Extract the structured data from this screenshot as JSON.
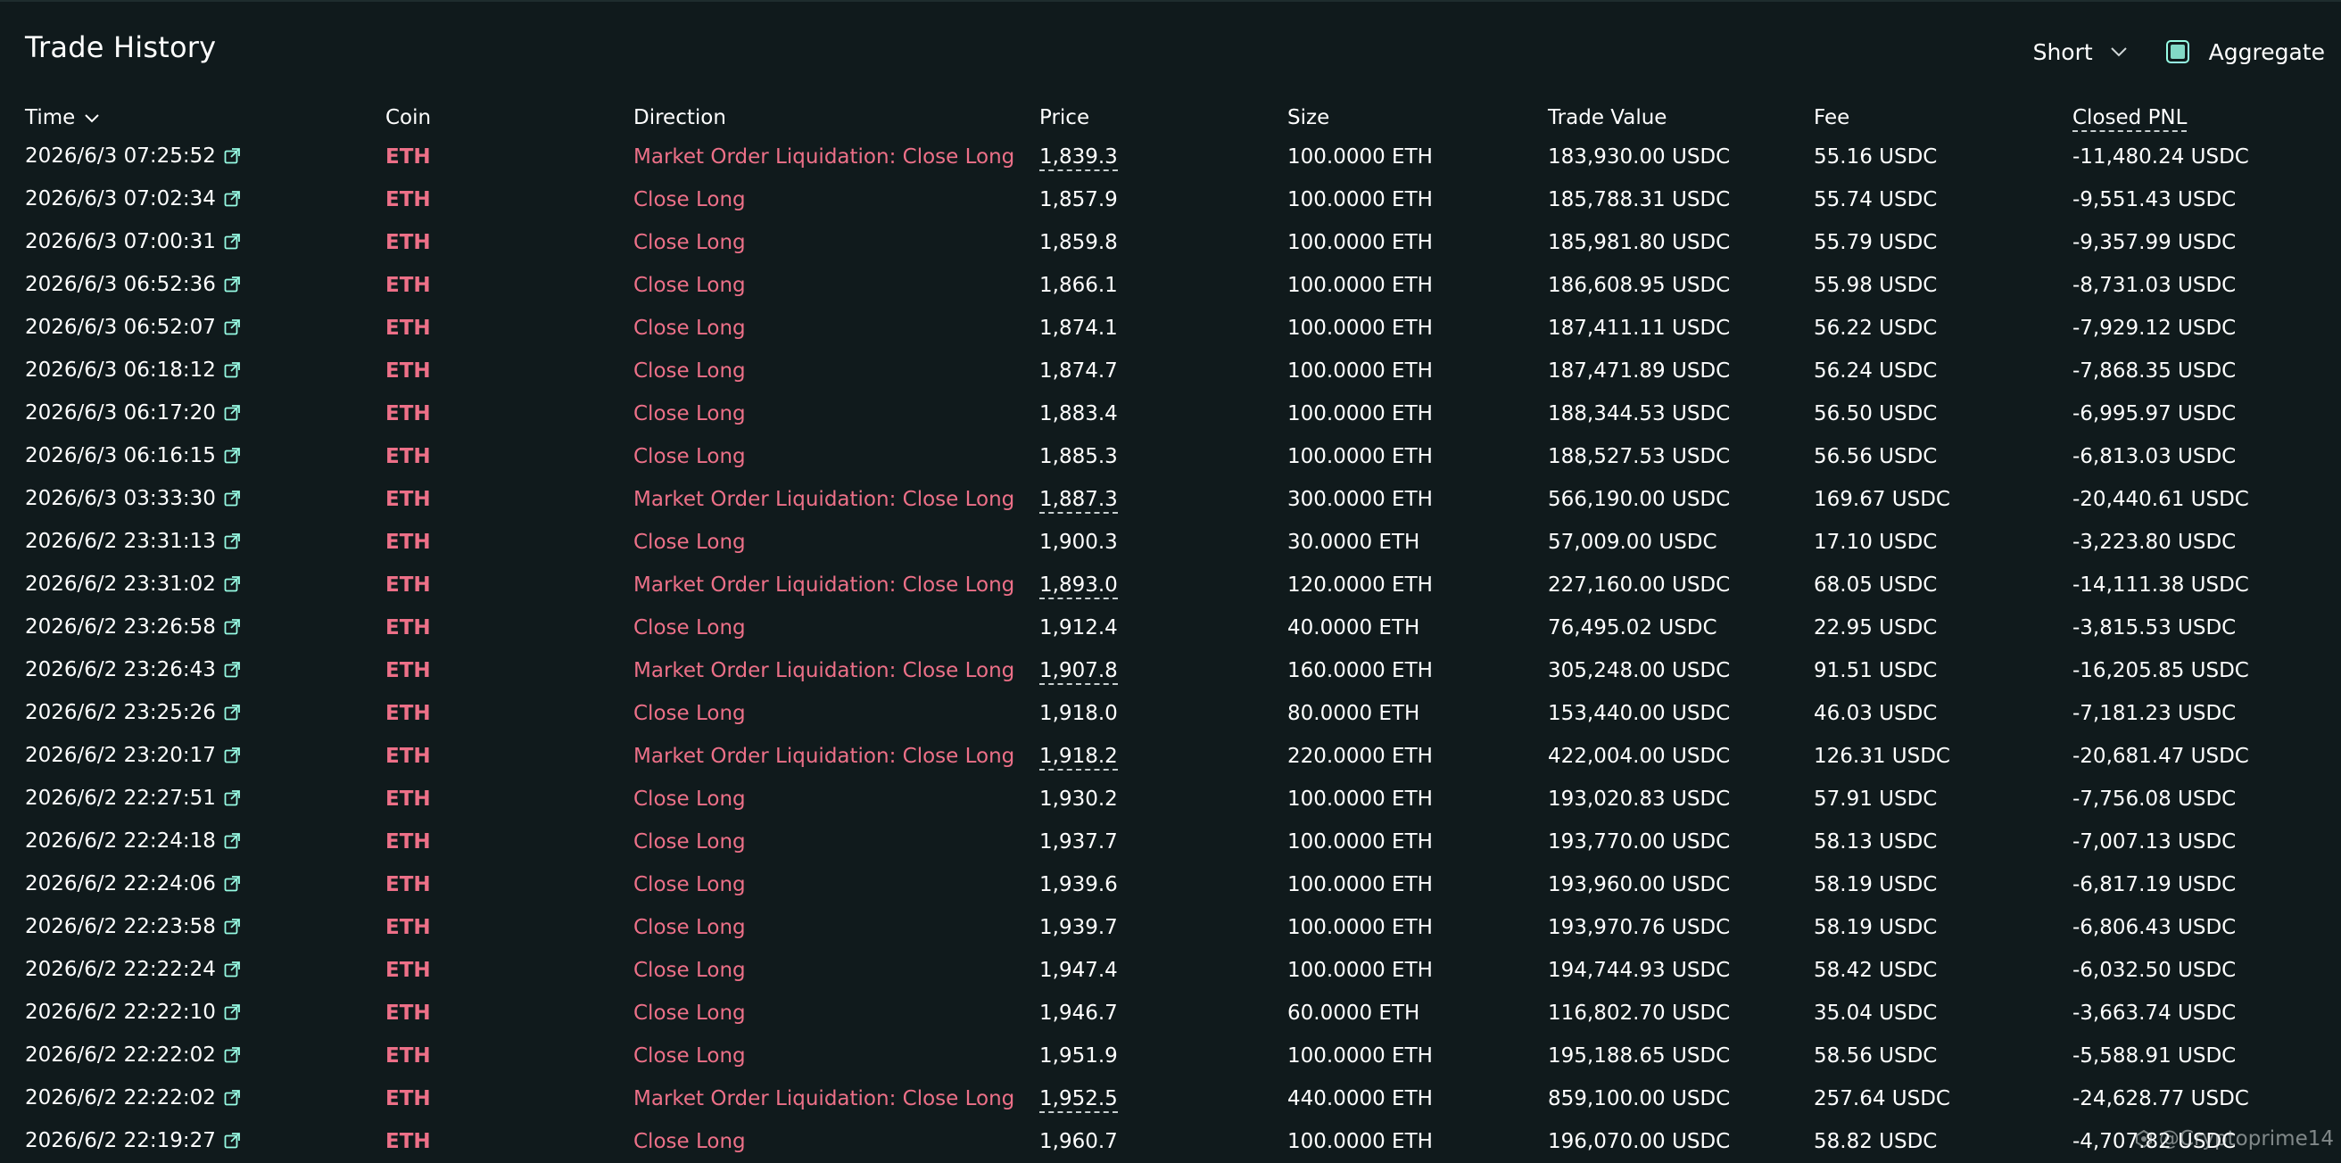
{
  "title": "Trade History",
  "controls": {
    "sort_value": "Short",
    "aggregate_label": "Aggregate",
    "aggregate_checked": true
  },
  "columns": {
    "time": "Time",
    "coin": "Coin",
    "direction": "Direction",
    "price": "Price",
    "size": "Size",
    "trade_value": "Trade Value",
    "fee": "Fee",
    "closed_pnl": "Closed PNL"
  },
  "rows": [
    {
      "time": "2026/6/3 07:25:52",
      "coin": "ETH",
      "direction": "Market Order Liquidation: Close Long",
      "price": "1,839.3",
      "price_dashed": true,
      "size": "100.0000 ETH",
      "trade_value": "183,930.00 USDC",
      "fee": "55.16 USDC",
      "pnl": "-11,480.24 USDC"
    },
    {
      "time": "2026/6/3 07:02:34",
      "coin": "ETH",
      "direction": "Close Long",
      "price": "1,857.9",
      "price_dashed": false,
      "size": "100.0000 ETH",
      "trade_value": "185,788.31 USDC",
      "fee": "55.74 USDC",
      "pnl": "-9,551.43 USDC"
    },
    {
      "time": "2026/6/3 07:00:31",
      "coin": "ETH",
      "direction": "Close Long",
      "price": "1,859.8",
      "price_dashed": false,
      "size": "100.0000 ETH",
      "trade_value": "185,981.80 USDC",
      "fee": "55.79 USDC",
      "pnl": "-9,357.99 USDC"
    },
    {
      "time": "2026/6/3 06:52:36",
      "coin": "ETH",
      "direction": "Close Long",
      "price": "1,866.1",
      "price_dashed": false,
      "size": "100.0000 ETH",
      "trade_value": "186,608.95 USDC",
      "fee": "55.98 USDC",
      "pnl": "-8,731.03 USDC"
    },
    {
      "time": "2026/6/3 06:52:07",
      "coin": "ETH",
      "direction": "Close Long",
      "price": "1,874.1",
      "price_dashed": false,
      "size": "100.0000 ETH",
      "trade_value": "187,411.11 USDC",
      "fee": "56.22 USDC",
      "pnl": "-7,929.12 USDC"
    },
    {
      "time": "2026/6/3 06:18:12",
      "coin": "ETH",
      "direction": "Close Long",
      "price": "1,874.7",
      "price_dashed": false,
      "size": "100.0000 ETH",
      "trade_value": "187,471.89 USDC",
      "fee": "56.24 USDC",
      "pnl": "-7,868.35 USDC"
    },
    {
      "time": "2026/6/3 06:17:20",
      "coin": "ETH",
      "direction": "Close Long",
      "price": "1,883.4",
      "price_dashed": false,
      "size": "100.0000 ETH",
      "trade_value": "188,344.53 USDC",
      "fee": "56.50 USDC",
      "pnl": "-6,995.97 USDC"
    },
    {
      "time": "2026/6/3 06:16:15",
      "coin": "ETH",
      "direction": "Close Long",
      "price": "1,885.3",
      "price_dashed": false,
      "size": "100.0000 ETH",
      "trade_value": "188,527.53 USDC",
      "fee": "56.56 USDC",
      "pnl": "-6,813.03 USDC"
    },
    {
      "time": "2026/6/3 03:33:30",
      "coin": "ETH",
      "direction": "Market Order Liquidation: Close Long",
      "price": "1,887.3",
      "price_dashed": true,
      "size": "300.0000 ETH",
      "trade_value": "566,190.00 USDC",
      "fee": "169.67 USDC",
      "pnl": "-20,440.61 USDC"
    },
    {
      "time": "2026/6/2 23:31:13",
      "coin": "ETH",
      "direction": "Close Long",
      "price": "1,900.3",
      "price_dashed": false,
      "size": "30.0000 ETH",
      "trade_value": "57,009.00 USDC",
      "fee": "17.10 USDC",
      "pnl": "-3,223.80 USDC"
    },
    {
      "time": "2026/6/2 23:31:02",
      "coin": "ETH",
      "direction": "Market Order Liquidation: Close Long",
      "price": "1,893.0",
      "price_dashed": true,
      "size": "120.0000 ETH",
      "trade_value": "227,160.00 USDC",
      "fee": "68.05 USDC",
      "pnl": "-14,111.38 USDC"
    },
    {
      "time": "2026/6/2 23:26:58",
      "coin": "ETH",
      "direction": "Close Long",
      "price": "1,912.4",
      "price_dashed": false,
      "size": "40.0000 ETH",
      "trade_value": "76,495.02 USDC",
      "fee": "22.95 USDC",
      "pnl": "-3,815.53 USDC"
    },
    {
      "time": "2026/6/2 23:26:43",
      "coin": "ETH",
      "direction": "Market Order Liquidation: Close Long",
      "price": "1,907.8",
      "price_dashed": true,
      "size": "160.0000 ETH",
      "trade_value": "305,248.00 USDC",
      "fee": "91.51 USDC",
      "pnl": "-16,205.85 USDC"
    },
    {
      "time": "2026/6/2 23:25:26",
      "coin": "ETH",
      "direction": "Close Long",
      "price": "1,918.0",
      "price_dashed": false,
      "size": "80.0000 ETH",
      "trade_value": "153,440.00 USDC",
      "fee": "46.03 USDC",
      "pnl": "-7,181.23 USDC"
    },
    {
      "time": "2026/6/2 23:20:17",
      "coin": "ETH",
      "direction": "Market Order Liquidation: Close Long",
      "price": "1,918.2",
      "price_dashed": true,
      "size": "220.0000 ETH",
      "trade_value": "422,004.00 USDC",
      "fee": "126.31 USDC",
      "pnl": "-20,681.47 USDC"
    },
    {
      "time": "2026/6/2 22:27:51",
      "coin": "ETH",
      "direction": "Close Long",
      "price": "1,930.2",
      "price_dashed": false,
      "size": "100.0000 ETH",
      "trade_value": "193,020.83 USDC",
      "fee": "57.91 USDC",
      "pnl": "-7,756.08 USDC"
    },
    {
      "time": "2026/6/2 22:24:18",
      "coin": "ETH",
      "direction": "Close Long",
      "price": "1,937.7",
      "price_dashed": false,
      "size": "100.0000 ETH",
      "trade_value": "193,770.00 USDC",
      "fee": "58.13 USDC",
      "pnl": "-7,007.13 USDC"
    },
    {
      "time": "2026/6/2 22:24:06",
      "coin": "ETH",
      "direction": "Close Long",
      "price": "1,939.6",
      "price_dashed": false,
      "size": "100.0000 ETH",
      "trade_value": "193,960.00 USDC",
      "fee": "58.19 USDC",
      "pnl": "-6,817.19 USDC"
    },
    {
      "time": "2026/6/2 22:23:58",
      "coin": "ETH",
      "direction": "Close Long",
      "price": "1,939.7",
      "price_dashed": false,
      "size": "100.0000 ETH",
      "trade_value": "193,970.76 USDC",
      "fee": "58.19 USDC",
      "pnl": "-6,806.43 USDC"
    },
    {
      "time": "2026/6/2 22:22:24",
      "coin": "ETH",
      "direction": "Close Long",
      "price": "1,947.4",
      "price_dashed": false,
      "size": "100.0000 ETH",
      "trade_value": "194,744.93 USDC",
      "fee": "58.42 USDC",
      "pnl": "-6,032.50 USDC"
    },
    {
      "time": "2026/6/2 22:22:10",
      "coin": "ETH",
      "direction": "Close Long",
      "price": "1,946.7",
      "price_dashed": false,
      "size": "60.0000 ETH",
      "trade_value": "116,802.70 USDC",
      "fee": "35.04 USDC",
      "pnl": "-3,663.74 USDC"
    },
    {
      "time": "2026/6/2 22:22:02",
      "coin": "ETH",
      "direction": "Close Long",
      "price": "1,951.9",
      "price_dashed": false,
      "size": "100.0000 ETH",
      "trade_value": "195,188.65 USDC",
      "fee": "58.56 USDC",
      "pnl": "-5,588.91 USDC"
    },
    {
      "time": "2026/6/2 22:22:02",
      "coin": "ETH",
      "direction": "Market Order Liquidation: Close Long",
      "price": "1,952.5",
      "price_dashed": true,
      "size": "440.0000 ETH",
      "trade_value": "859,100.00 USDC",
      "fee": "257.64 USDC",
      "pnl": "-24,628.77 USDC"
    },
    {
      "time": "2026/6/2 22:19:27",
      "coin": "ETH",
      "direction": "Close Long",
      "price": "1,960.7",
      "price_dashed": false,
      "size": "100.0000 ETH",
      "trade_value": "196,070.00 USDC",
      "fee": "58.82 USDC",
      "pnl": "-4,707.82 USDC"
    }
  ],
  "watermark": "@Cryptoprime14",
  "colors": {
    "background": "#101a1c",
    "sell_red": "#ed7088",
    "accent": "#97fce4"
  }
}
